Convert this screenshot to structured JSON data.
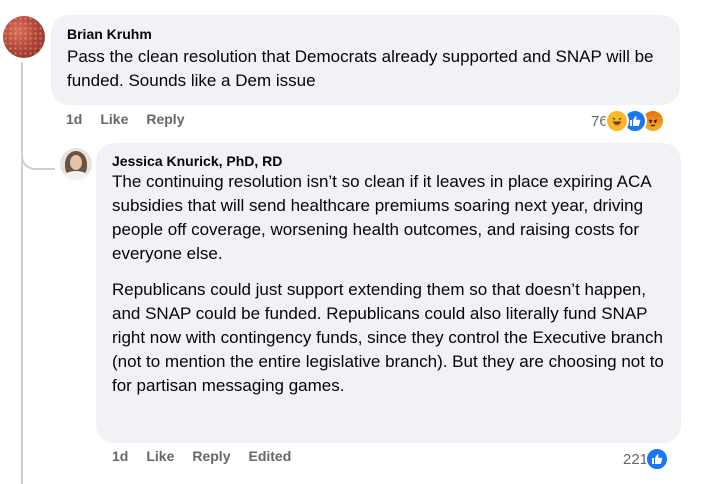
{
  "comments": [
    {
      "author": "Brian Kruhm",
      "paragraphs": [
        "Pass the clean resolution that Democrats already supported and SNAP will be funded. Sounds like a Dem issue"
      ],
      "time": "1d",
      "like_label": "Like",
      "reply_label": "Reply",
      "reaction_count": "76",
      "reactions": [
        "haha-icon",
        "like-icon",
        "angry-icon"
      ]
    }
  ],
  "reply": {
    "author": "Jessica Knurick, PhD, RD",
    "paragraphs": [
      "The continuing resolution isn’t so clean if it leaves in place expiring ACA subsidies that will send healthcare premiums soaring next year, driving people off coverage, worsening health outcomes, and raising costs for everyone else.",
      "Republicans could just support extending them so that doesn’t happen, and SNAP could be funded. Republicans could also literally fund SNAP right now with contingency funds, since they control the Executive branch (not to mention the entire legislative branch). But they are choosing not to for partisan messaging games."
    ],
    "time": "1d",
    "like_label": "Like",
    "reply_label": "Reply",
    "edited_label": "Edited",
    "reaction_count": "221",
    "reactions": [
      "like-icon"
    ]
  },
  "colors": {
    "bubble": "#f0f2f5",
    "meta_text": "#65676b",
    "like_blue": "#1877f2",
    "haha_yellow": "#f7b928"
  }
}
